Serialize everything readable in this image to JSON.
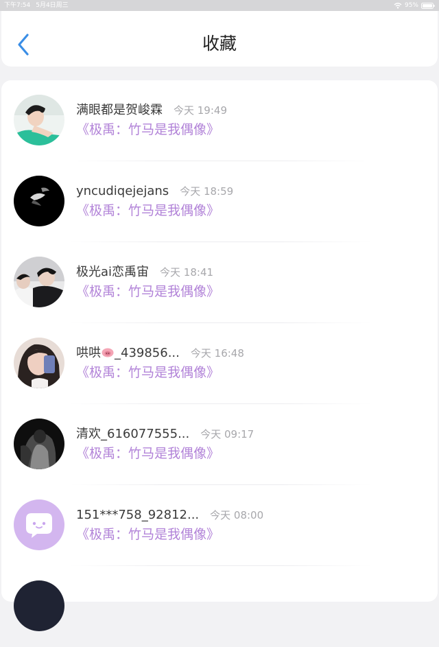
{
  "status_bar": {
    "time": "下午7:54",
    "date": "5月4日周三",
    "battery": "95%"
  },
  "header": {
    "title": "收藏"
  },
  "favorites": [
    {
      "name": "满眼都是贺峻霖",
      "time": "今天 19:49",
      "title": "《极禹：竹马是我偶像》"
    },
    {
      "name": "yncudiqejejans",
      "time": "今天 18:59",
      "title": "《极禹：竹马是我偶像》"
    },
    {
      "name": "极光ai恋禹宙",
      "time": "今天 18:41",
      "title": "《极禹：竹马是我偶像》"
    },
    {
      "name_prefix": "哄哄",
      "name_suffix": "_439856...",
      "time": "今天 16:48",
      "title": "《极禹：竹马是我偶像》"
    },
    {
      "name": "清欢_616077555...",
      "time": "今天 09:17",
      "title": "《极禹：竹马是我偶像》"
    },
    {
      "name": "151***758_92812...",
      "time": "今天 08:00",
      "title": "《极禹：竹马是我偶像》"
    }
  ],
  "colors": {
    "accent_blue": "#3a8ee6",
    "title_purple": "#b283d8",
    "timestamp_gray": "#a7a7ab"
  },
  "icons": {
    "back": "chevron-left-icon",
    "wifi": "wifi-icon",
    "battery": "battery-icon",
    "pig": "pig-face-emoji",
    "default_avatar": "chat-bubble-face-icon"
  }
}
